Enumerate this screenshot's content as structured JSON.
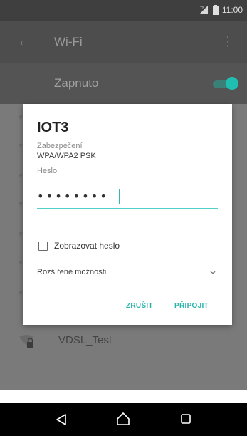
{
  "status_bar": {
    "time": "11:00"
  },
  "toolbar": {
    "title": "Wi-Fi"
  },
  "wifi_switch": {
    "label": "Zapnuto",
    "enabled": true,
    "accent_color": "#20bdb1"
  },
  "network_list": [
    {
      "name": "VDSL_Test",
      "secured": true
    }
  ],
  "dialog": {
    "title": "IOT3",
    "security_label": "Zabezpečení",
    "security_value": "WPA/WPA2 PSK",
    "password_label": "Heslo",
    "password_value": "••••••••",
    "show_password_label": "Zobrazovat heslo",
    "show_password_checked": false,
    "advanced_label": "Rozšířené možnosti",
    "cancel_label": "ZRUŠIT",
    "connect_label": "PŘIPOJIT"
  },
  "nav_bar": {
    "back_icon": "back-triangle",
    "home_icon": "home-house",
    "recents_icon": "recents-square"
  }
}
